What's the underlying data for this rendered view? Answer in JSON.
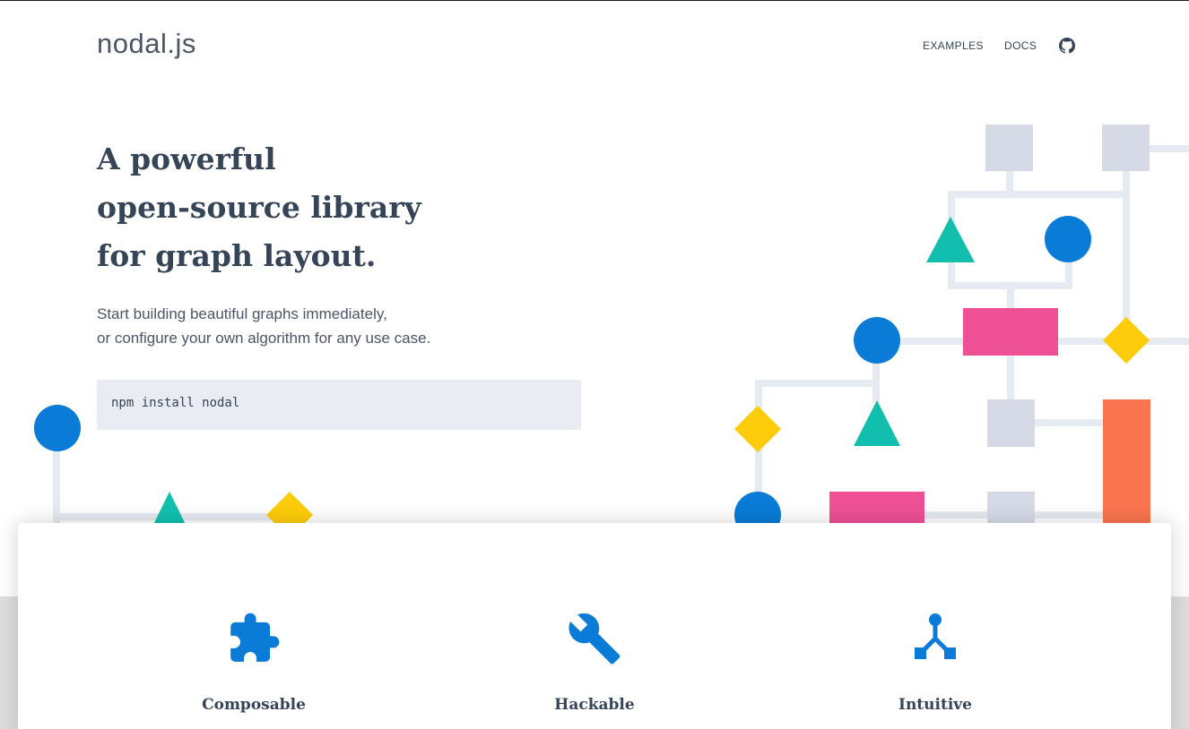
{
  "header": {
    "logo": "nodal.js",
    "nav": [
      {
        "label": "EXAMPLES"
      },
      {
        "label": "DOCS"
      }
    ],
    "github_icon": "github-icon"
  },
  "hero": {
    "title_lines": [
      "A powerful",
      "open-source library",
      "for graph layout."
    ],
    "subtitle_lines": [
      "Start building beautiful graphs immediately,",
      "or configure your own algorithm for any use case."
    ],
    "install_command": "npm install nodal"
  },
  "features": [
    {
      "title": "Composable",
      "icon": "puzzle-icon"
    },
    {
      "title": "Hackable",
      "icon": "wrench-icon"
    },
    {
      "title": "Intuitive",
      "icon": "tree-branch-icon"
    }
  ],
  "colors": {
    "blue": "#0A7BD6",
    "teal": "#12BFAE",
    "yellow": "#FECC0A",
    "pink": "#EE5096",
    "orange": "#FA7550",
    "gray_node": "#D6DAE6",
    "edge": "#E6EAF1",
    "text": "#364458"
  }
}
